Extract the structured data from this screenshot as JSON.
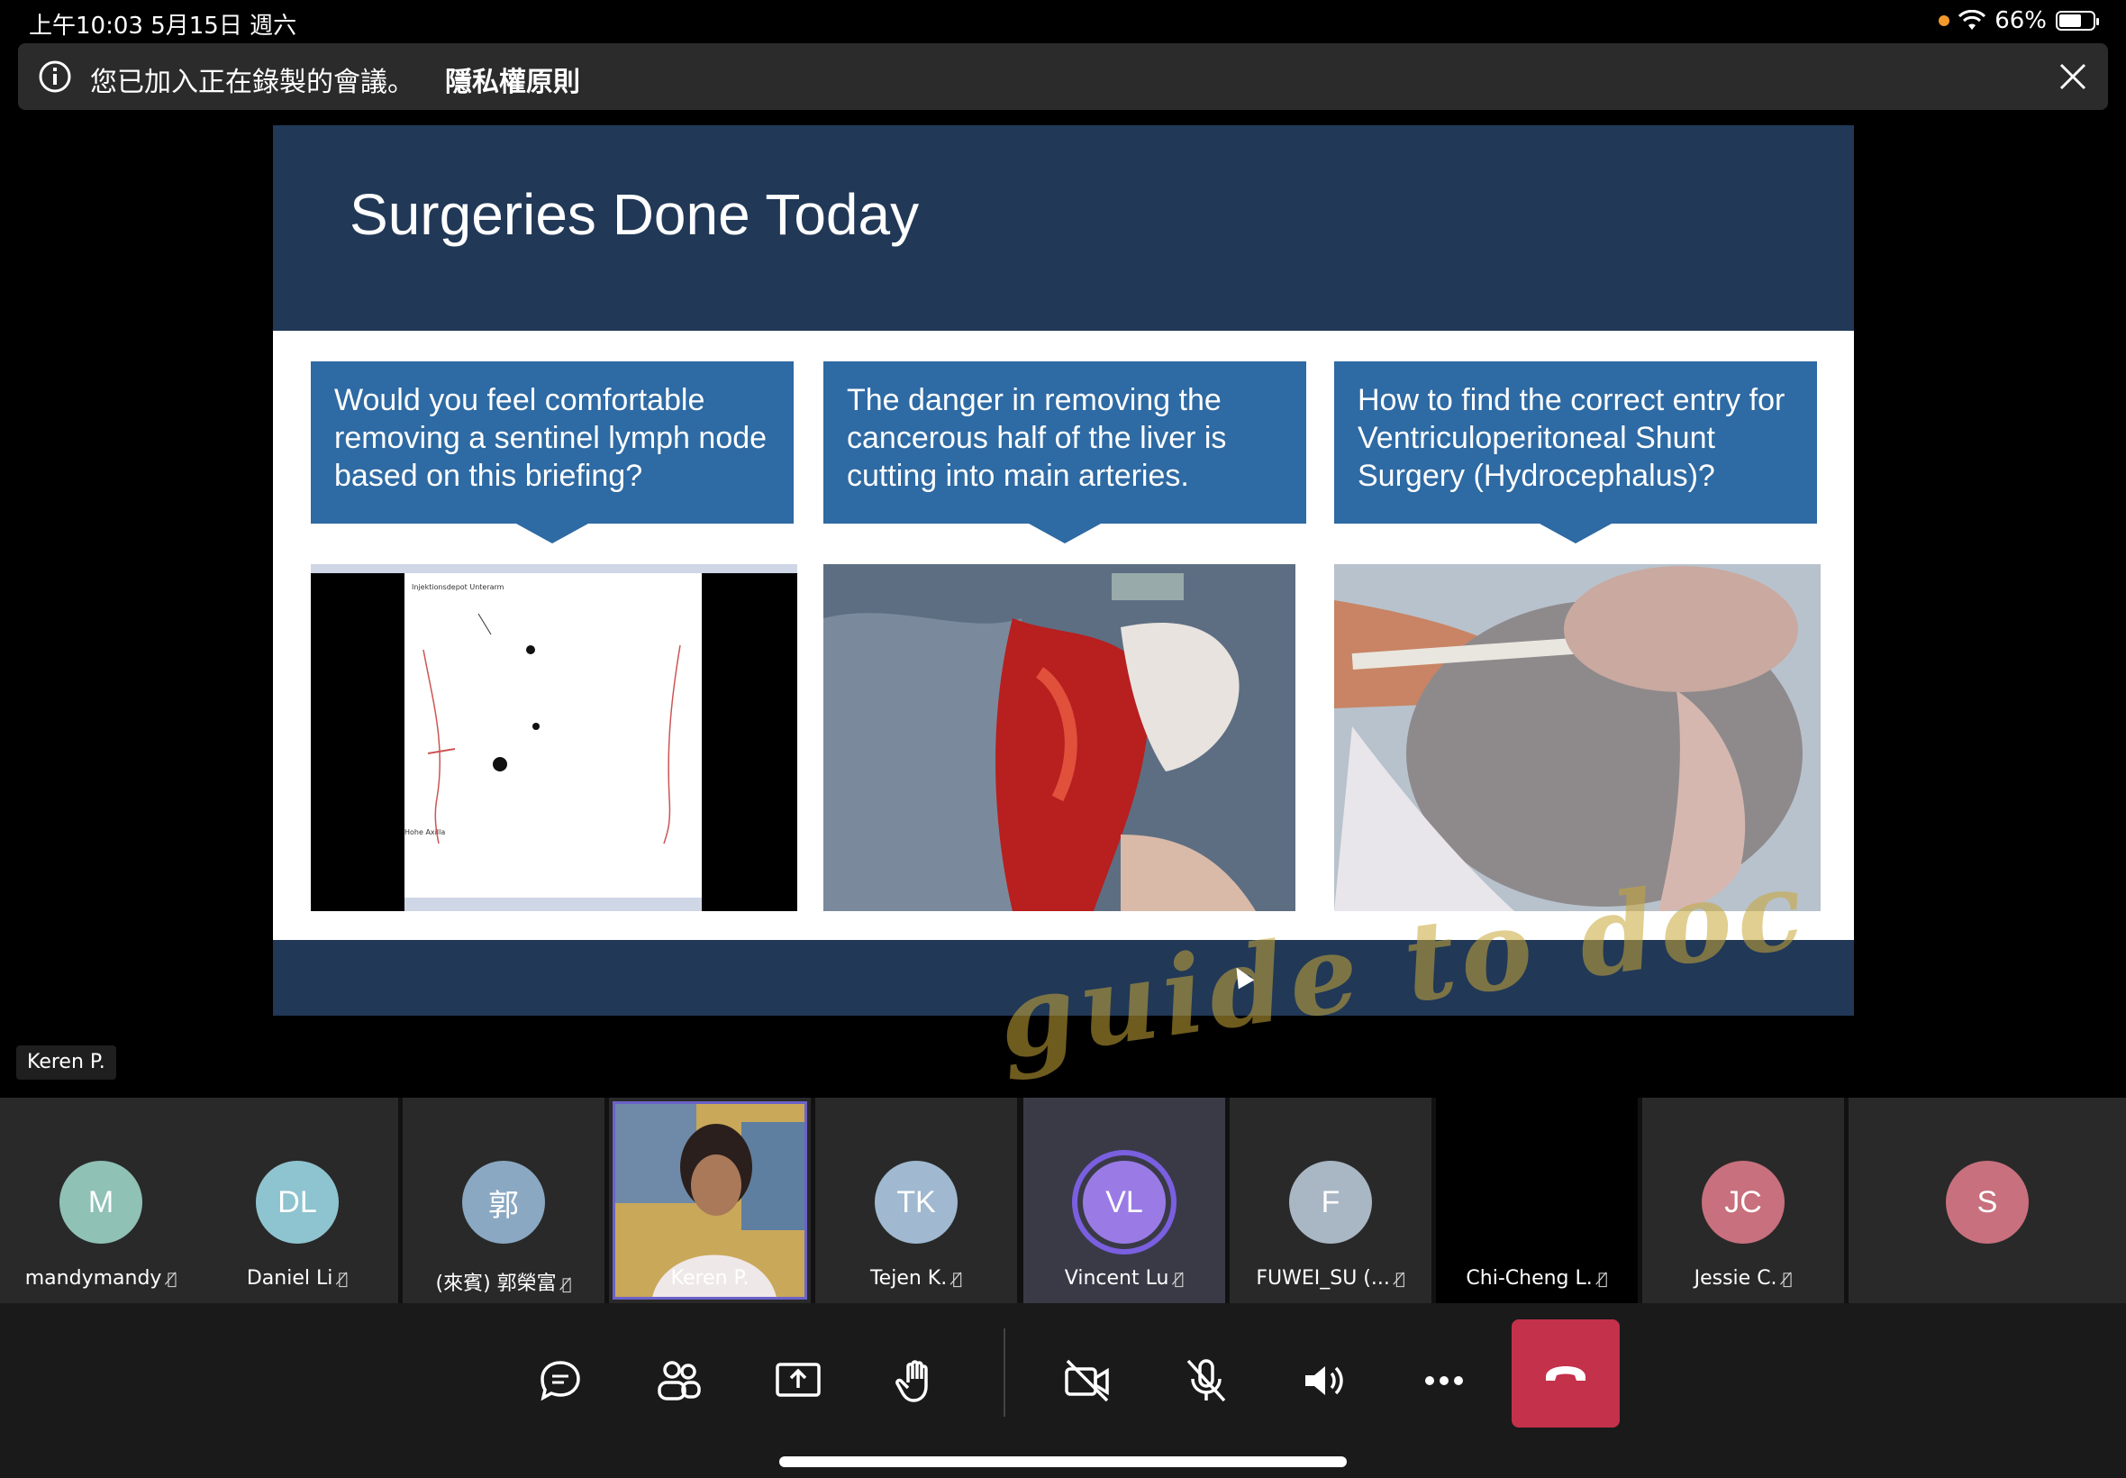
{
  "status_bar": {
    "time": "上午10:03  5月15日 週六",
    "battery": "66%",
    "battery_level": 0.66
  },
  "banner": {
    "message": "您已加入正在錄製的會議。",
    "privacy_link": "隱私權原則"
  },
  "slide": {
    "title": "Surgeries Done Today",
    "callouts": [
      "Would you feel comfortable removing a sentinel lymph node based on this briefing?",
      "The danger in removing the cancerous half of the liver is cutting into main arteries.",
      "How to find the correct entry for Ventriculoperitoneal Shunt Surgery (Hydrocephalus)?"
    ],
    "scan_labels": [
      "Injektionsdepot Unterarm",
      "Hohe Axilla"
    ],
    "watermark": "guide to doc"
  },
  "speaker_label": "Keren P.",
  "participants": [
    {
      "name": "mandymandy",
      "initials": "M",
      "color": "#8fc1b5"
    },
    {
      "name": "Daniel Li",
      "initials": "DL",
      "color": "#8ec4cf"
    },
    {
      "name": "(來賓) 郭榮富",
      "initials": "郭",
      "color": "#8aa8c2"
    },
    {
      "name": "Keren P.",
      "initials": "",
      "color": ""
    },
    {
      "name": "Tejen K.",
      "initials": "TK",
      "color": "#a0b8d0"
    },
    {
      "name": "Vincent Lu",
      "initials": "VL",
      "color": "#9a7be6"
    },
    {
      "name": "FUWEI_SU (...",
      "initials": "F",
      "color": "#a9b6c3"
    },
    {
      "name": "Chi-Cheng L.",
      "initials": "",
      "color": ""
    },
    {
      "name": "Jessie C.",
      "initials": "JC",
      "color": "#c8707d"
    },
    {
      "name": "",
      "initials": "S",
      "color": "#c8707d"
    }
  ],
  "controls": {
    "chat_icon": "chat-icon",
    "participants_icon": "participants-icon",
    "share_icon": "share-screen-icon",
    "raise_hand_icon": "raise-hand-icon",
    "camera_icon": "camera-off-icon",
    "mic_icon": "mic-off-icon",
    "speaker_icon": "speaker-icon",
    "more_icon": "more-icon",
    "hangup_icon": "hang-up-icon"
  }
}
